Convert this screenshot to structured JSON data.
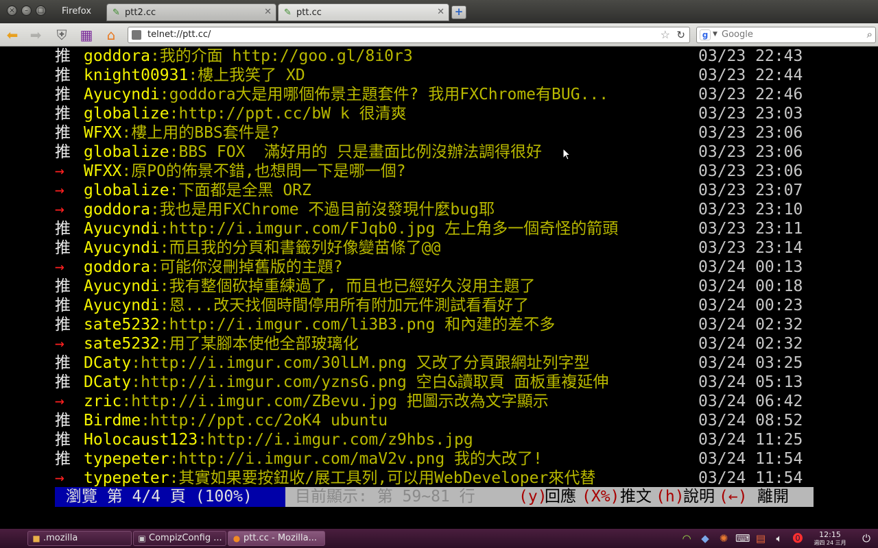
{
  "window": {
    "app_title": "Firefox",
    "tabs": [
      {
        "label": "ptt2.cc",
        "close": "✕"
      },
      {
        "label": "ptt.cc",
        "close": "✕"
      }
    ],
    "new_tab": "+"
  },
  "navbar": {
    "url": "telnet://ptt.cc/",
    "search_placeholder": "Google",
    "search_engine": "g"
  },
  "colors": {
    "terminal_bg": "#000000",
    "push_mark": "#e8e8e8",
    "arrow_mark": "#ff2020",
    "user": "#f4f400",
    "message": "#b8b800",
    "timestamp": "#c8c8c8",
    "status_page_bg": "#0000a8",
    "status_rest_bg": "#b8b8b8",
    "status_key": "#a80000"
  },
  "terminal": {
    "lines": [
      {
        "mark": "推",
        "user": "goddora",
        "msg": ":我的介面 http://goo.gl/8i0r3",
        "time": "03/23 22:43"
      },
      {
        "mark": "推",
        "user": "knight00931",
        "msg": ":樓上我笑了 XD",
        "time": "03/23 22:44"
      },
      {
        "mark": "推",
        "user": "Ayucyndi",
        "msg": ":goddora大是用哪個佈景主題套件? 我用FXChrome有BUG...",
        "time": "03/23 22:46"
      },
      {
        "mark": "推",
        "user": "globalize",
        "msg": ":http://ppt.cc/bW k 很清爽",
        "time": "03/23 23:03"
      },
      {
        "mark": "推",
        "user": "WFXX",
        "msg": ":樓上用的BBS套件是?",
        "time": "03/23 23:06"
      },
      {
        "mark": "推",
        "user": "globalize",
        "msg": ":BBS FOX  滿好用的 只是畫面比例沒辦法調得很好",
        "time": "03/23 23:06"
      },
      {
        "mark": "→",
        "user": "WFXX",
        "msg": ":原PO的佈景不錯,也想問一下是哪一個?",
        "time": "03/23 23:06"
      },
      {
        "mark": "→",
        "user": "globalize",
        "msg": ":下面都是全黑 ORZ",
        "time": "03/23 23:07"
      },
      {
        "mark": "→",
        "user": "goddora",
        "msg": ":我也是用FXChrome 不過目前沒發現什麼bug耶",
        "time": "03/23 23:10"
      },
      {
        "mark": "推",
        "user": "Ayucyndi",
        "msg": ":http://i.imgur.com/FJqb0.jpg 左上角多一個奇怪的箭頭",
        "time": "03/23 23:11"
      },
      {
        "mark": "推",
        "user": "Ayucyndi",
        "msg": ":而且我的分頁和書籤列好像變苗條了@@",
        "time": "03/23 23:14"
      },
      {
        "mark": "→",
        "user": "goddora",
        "msg": ":可能你沒刪掉舊版的主題?",
        "time": "03/24 00:13"
      },
      {
        "mark": "推",
        "user": "Ayucyndi",
        "msg": ":我有整個砍掉重練過了, 而且也已經好久沒用主題了",
        "time": "03/24 00:18"
      },
      {
        "mark": "推",
        "user": "Ayucyndi",
        "msg": ":恩...改天找個時間停用所有附加元件測試看看好了",
        "time": "03/24 00:23"
      },
      {
        "mark": "推",
        "user": "sate5232",
        "msg": ":http://i.imgur.com/li3B3.png 和內建的差不多",
        "time": "03/24 02:32"
      },
      {
        "mark": "→",
        "user": "sate5232",
        "msg": ":用了某腳本使他全部玻璃化",
        "time": "03/24 02:32"
      },
      {
        "mark": "推",
        "user": "DCaty",
        "msg": ":http://i.imgur.com/30lLM.png 又改了分頁跟網址列字型",
        "time": "03/24 03:25"
      },
      {
        "mark": "推",
        "user": "DCaty",
        "msg": ":http://i.imgur.com/yznsG.png 空白&讀取頁 面板重複延伸",
        "time": "03/24 05:13"
      },
      {
        "mark": "→",
        "user": "zric",
        "msg": ":http://i.imgur.com/ZBevu.jpg 把圖示改為文字顯示",
        "time": "03/24 06:42"
      },
      {
        "mark": "推",
        "user": "Birdme",
        "msg": ":http://ppt.cc/2oK4 ubuntu",
        "time": "03/24 08:52"
      },
      {
        "mark": "推",
        "user": "Holocaust123",
        "msg": ":http://i.imgur.com/z9hbs.jpg",
        "time": "03/24 11:25"
      },
      {
        "mark": "推",
        "user": "typepeter",
        "msg": ":http://i.imgur.com/maV2v.png 我的大改了!",
        "time": "03/24 11:54"
      },
      {
        "mark": "→",
        "user": "typepeter",
        "msg": ":其實如果要按鈕收/展工具列,可以用WebDeveloper來代替",
        "time": "03/24 11:54"
      }
    ],
    "status": {
      "page": " 瀏覽 第 4/4 頁 (100%)",
      "lines": "目前顯示: 第 59~81 行",
      "k_reply": "(y)",
      "l_reply": "回應",
      "k_push": "(X%)",
      "l_push": "推文",
      "k_help": "(h)",
      "l_help": "說明",
      "k_leave": "(←)",
      "l_leave": "離開"
    }
  },
  "taskbar": {
    "tasks": [
      {
        "label": ".mozilla"
      },
      {
        "label": "CompizConfig ..."
      },
      {
        "label": "ptt.cc - Mozilla..."
      }
    ],
    "clock_time": "12:15",
    "clock_date": "週四 24 三月"
  }
}
